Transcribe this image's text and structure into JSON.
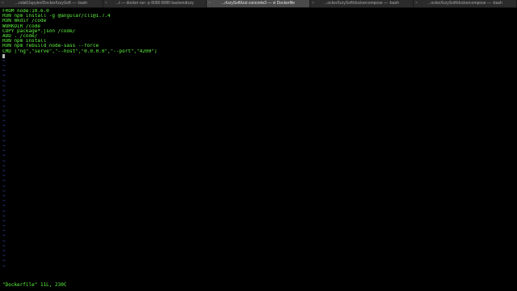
{
  "tabs": [
    {
      "label": "...ndall/Jupyter/Docker/IzzySoft — -bash",
      "active": false
    },
    {
      "label": "...t — docker run -p 8080:8080 backendizzy",
      "active": false
    },
    {
      "label": "...rIzzySoft/izzi-concrete3 — vi Dockerfile",
      "active": true
    },
    {
      "label": "...ocker/IzzySoft/dockercompose — -bash",
      "active": false
    },
    {
      "label": "...ocker/IzzySoft/dockercompose — -bash",
      "active": false
    }
  ],
  "file_lines": [
    "FROM node:10.6.0",
    "RUN npm install -g @angular/cli@1.7.4",
    "RUN mkdir /code",
    "WORKDIR /code",
    "COPY package*.json /code/",
    "ADD . /code/",
    "RUN npm install",
    "RUN npm rebuild node-sass --force",
    "CMD [\"ng\",\"serve\",\"--host\",\"0.0.0.0\",\"--port\",\"4200\"]"
  ],
  "empty_marker": "~",
  "empty_line_count": 42,
  "status": "\"Dockerfile\" 11L, 230C",
  "colors": {
    "text": "#5df53d",
    "tilde": "#3f5bd8",
    "background": "#000000"
  }
}
